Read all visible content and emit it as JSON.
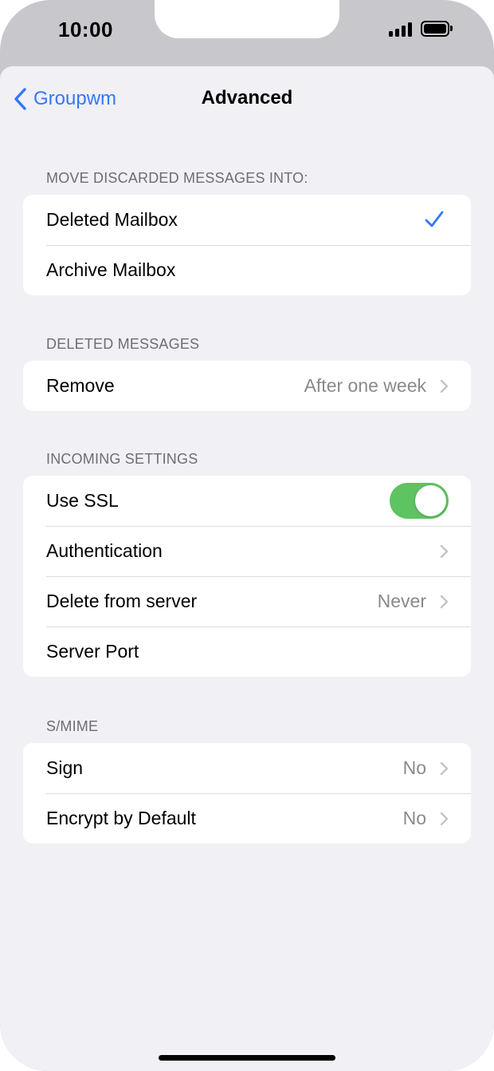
{
  "status_bar": {
    "time": "10:00"
  },
  "nav": {
    "back_label": "Groupwm",
    "title": "Advanced"
  },
  "sections": {
    "discarded": {
      "header": "MOVE DISCARDED MESSAGES INTO:",
      "deleted_mailbox": "Deleted Mailbox",
      "archive_mailbox": "Archive Mailbox",
      "selected": "Deleted Mailbox"
    },
    "deleted_messages": {
      "header": "DELETED MESSAGES",
      "remove_label": "Remove",
      "remove_value": "After one week"
    },
    "incoming": {
      "header": "INCOMING SETTINGS",
      "use_ssl_label": "Use SSL",
      "use_ssl_on": true,
      "authentication_label": "Authentication",
      "delete_from_server_label": "Delete from server",
      "delete_from_server_value": "Never",
      "server_port_label": "Server Port"
    },
    "smime": {
      "header": "S/MIME",
      "sign_label": "Sign",
      "sign_value": "No",
      "encrypt_label": "Encrypt by Default",
      "encrypt_value": "No"
    }
  },
  "colors": {
    "accent": "#3478f6",
    "toggle_on": "#5ec361",
    "background": "#f0f0f5",
    "secondary_text": "#8a8a8e"
  },
  "icons": [
    "chevron-left-icon",
    "checkmark-icon",
    "chevron-right-icon",
    "signal-icon",
    "battery-icon"
  ]
}
